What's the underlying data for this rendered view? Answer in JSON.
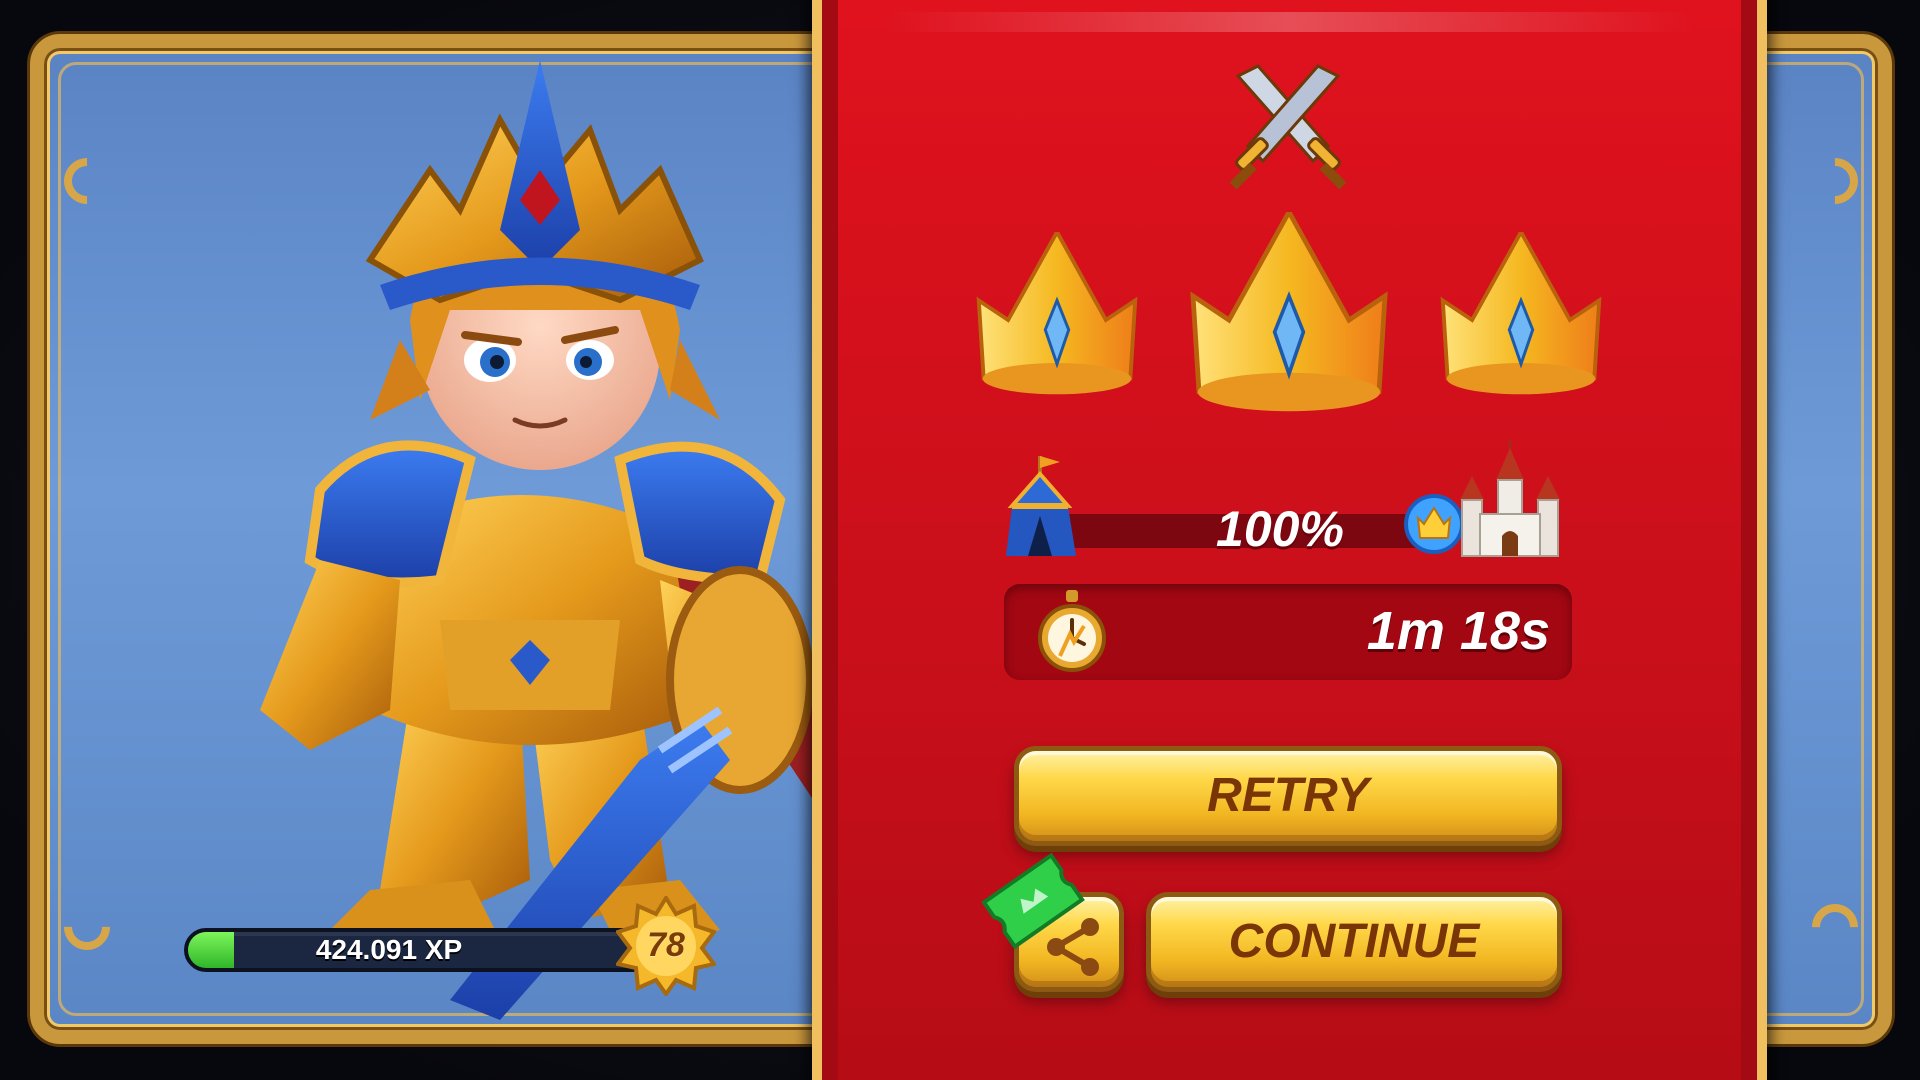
{
  "hero": {
    "xp_label": "424.091 XP",
    "xp_progress": 0.1,
    "level": "78"
  },
  "result": {
    "crowns_earned": 3,
    "progress_percent": "100%",
    "time": "1m 18s"
  },
  "buttons": {
    "retry_label": "RETRY",
    "continue_label": "CONTINUE"
  },
  "icons": {
    "swords": "crossed-swords-icon",
    "crown": "crown-icon",
    "tent": "tent-icon",
    "castle": "castle-icon",
    "stopwatch": "stopwatch-icon",
    "share": "share-icon",
    "ticket": "ticket-icon"
  },
  "colors": {
    "banner_red": "#d0101b",
    "gold": "#f2b722",
    "button_text": "#7a3506",
    "xp_green": "#49d23a"
  }
}
